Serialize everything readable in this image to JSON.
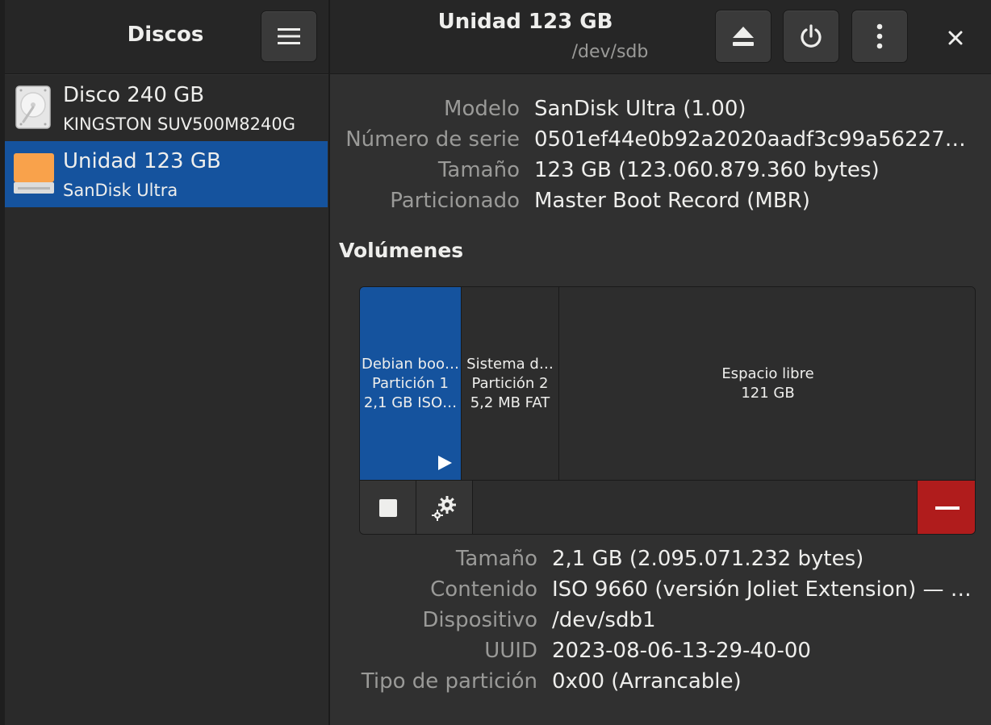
{
  "sidebar": {
    "title": "Discos",
    "disks": [
      {
        "name": "Disco 240 GB",
        "model": "KINGSTON SUV500M8240G",
        "selected": false,
        "icon": "hard-disk-icon"
      },
      {
        "name": "Unidad 123 GB",
        "model": "SanDisk Ultra",
        "selected": true,
        "icon": "usb-drive-icon"
      }
    ]
  },
  "header": {
    "title": "Unidad 123 GB",
    "subtitle": "/dev/sdb",
    "buttons": [
      "eject-icon",
      "power-icon",
      "more-options-icon",
      "close-icon"
    ]
  },
  "drive": {
    "model_label": "Modelo",
    "model_value": "SanDisk Ultra (1.00)",
    "serial_label": "Número de serie",
    "serial_value": "0501ef44e0b92a2020aadf3c99a56227…",
    "size_label": "Tamaño",
    "size_value": "123 GB (123.060.879.360 bytes)",
    "partitioning_label": "Particionado",
    "partitioning_value": "Master Boot Record (MBR)"
  },
  "volumes": {
    "title": "Volúmenes",
    "segments": [
      {
        "line1": "Debian boo…",
        "line2": "Partición 1",
        "line3": "2,1 GB ISO…"
      },
      {
        "line1": "Sistema d…",
        "line2": "Partición 2",
        "line3": "5,2 MB FAT"
      },
      {
        "line1": "Espacio libre",
        "line2": "121 GB"
      }
    ]
  },
  "volume": {
    "size_label": "Tamaño",
    "size_value": "2,1 GB (2.095.071.232 bytes)",
    "content_label": "Contenido",
    "content_value": "ISO 9660 (versión Joliet Extension) — …",
    "device_label": "Dispositivo",
    "device_value": "/dev/sdb1",
    "uuid_label": "UUID",
    "uuid_value": "2023-08-06-13-29-40-00",
    "type_label": "Tipo de partición",
    "type_value": "0x00 (Arrancable)"
  },
  "colors": {
    "accent": "#15539e",
    "danger": "#b01c1c",
    "usb_drive": "#f9a24b"
  }
}
